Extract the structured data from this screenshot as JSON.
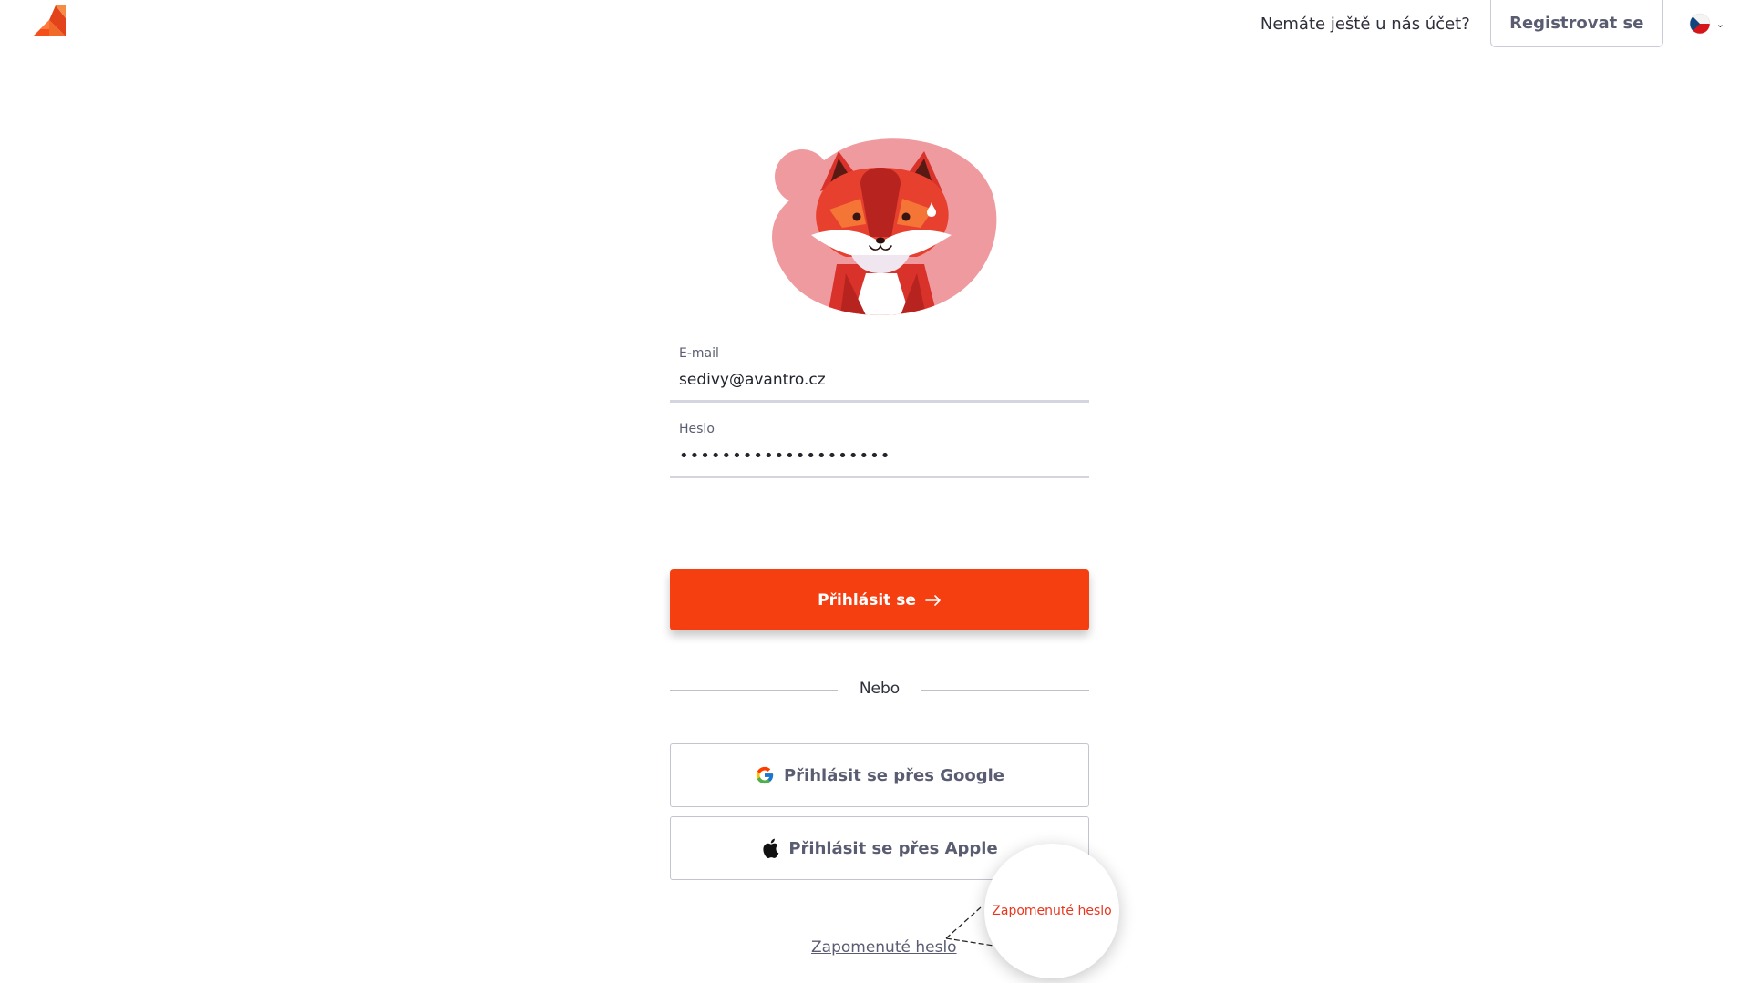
{
  "header": {
    "no_account_text": "Nemáte ještě u nás účet?",
    "register_label": "Registrovat se",
    "language_icon": "czech-flag-icon"
  },
  "form": {
    "email_label": "E-mail",
    "email_value": "sedivy@avantro.cz",
    "password_label": "Heslo",
    "password_value": "••••••••••••••••••••",
    "login_label": "Přihlásit se",
    "login_icon": "arrow-right-icon",
    "divider_text": "Nebo",
    "google_label": "Přihlásit se přes Google",
    "apple_label": "Přihlásit se přes Apple",
    "forgot_label": "Zapomenuté heslo"
  },
  "callout": {
    "zoom_text": "Zapomenuté heslo"
  },
  "colors": {
    "accent": "#f53f11",
    "mascot_bg": "#ef9a9f",
    "link": "#5a5d72"
  }
}
